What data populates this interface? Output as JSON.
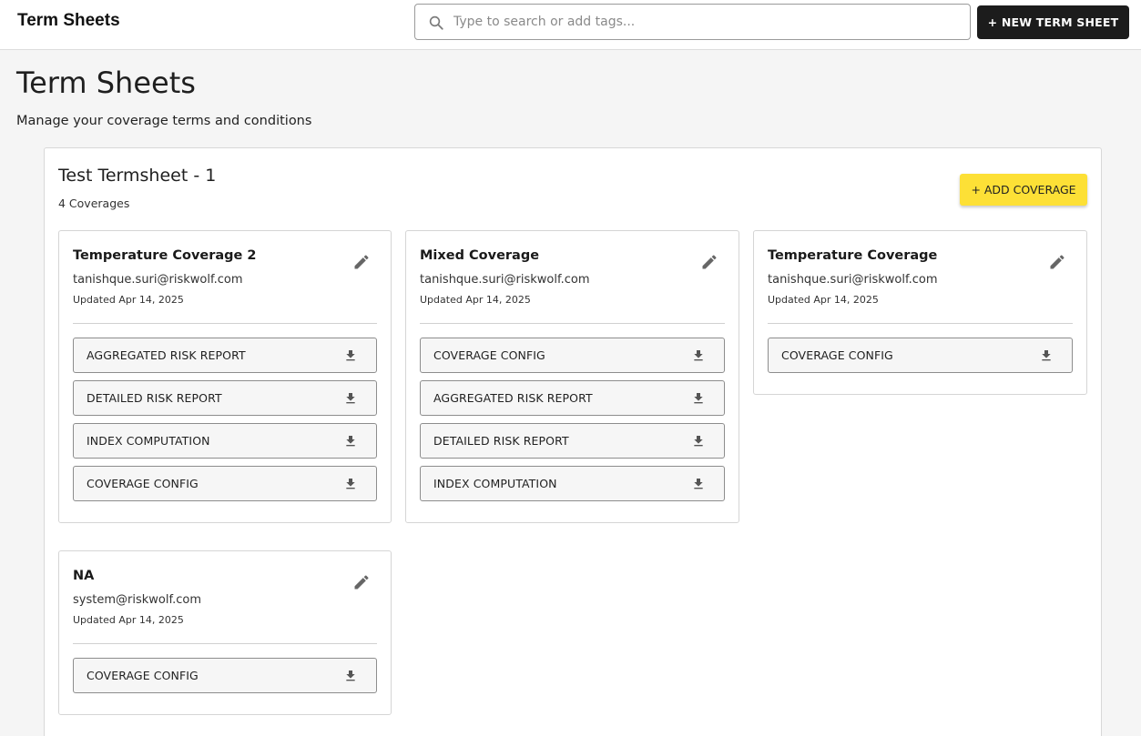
{
  "header": {
    "app_title": "Term Sheets",
    "search_placeholder": "Type to search or add tags...",
    "search_value": "",
    "new_button_label": "+ NEW TERM SHEET"
  },
  "page": {
    "title": "Term Sheets",
    "subtitle": "Manage your coverage terms and conditions"
  },
  "termsheet": {
    "title": "Test Termsheet - 1",
    "coverage_count": "4 Coverages",
    "add_coverage_label": "+ ADD COVERAGE",
    "accent_color": "#fde036",
    "cards": [
      {
        "name": "Temperature Coverage 2",
        "email": "tanishque.suri@riskwolf.com",
        "updated": "Updated Apr 14, 2025",
        "files": [
          "AGGREGATED RISK REPORT",
          "DETAILED RISK REPORT",
          "INDEX COMPUTATION",
          "COVERAGE CONFIG"
        ]
      },
      {
        "name": "Mixed Coverage",
        "email": "tanishque.suri@riskwolf.com",
        "updated": "Updated Apr 14, 2025",
        "files": [
          "COVERAGE CONFIG",
          "AGGREGATED RISK REPORT",
          "DETAILED RISK REPORT",
          "INDEX COMPUTATION"
        ]
      },
      {
        "name": "Temperature Coverage",
        "email": "tanishque.suri@riskwolf.com",
        "updated": "Updated Apr 14, 2025",
        "files": [
          "COVERAGE CONFIG"
        ]
      },
      {
        "name": "NA",
        "email": "system@riskwolf.com",
        "updated": "Updated Apr 14, 2025",
        "files": [
          "COVERAGE CONFIG"
        ]
      }
    ]
  },
  "icons": {
    "search": "search-icon",
    "edit": "pencil-icon",
    "download": "download-icon"
  }
}
